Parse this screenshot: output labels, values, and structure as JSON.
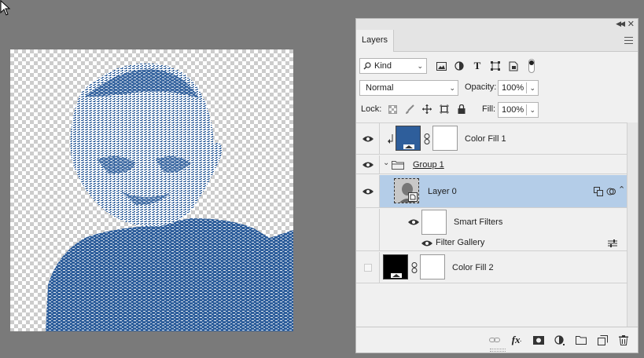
{
  "panel": {
    "tab_label": "Layers",
    "kind_filter": "Kind",
    "blend_mode": "Normal",
    "opacity_label": "Opacity:",
    "opacity_value": "100%",
    "lock_label": "Lock:",
    "fill_label": "Fill:",
    "fill_value": "100%"
  },
  "layers": [
    {
      "name": "Color Fill 1",
      "visible": true,
      "thumb_color": "#2e5e9b",
      "clipped": true
    },
    {
      "name": "Group 1",
      "visible": true,
      "type": "group"
    },
    {
      "name": "Layer 0",
      "visible": true,
      "selected": true,
      "type": "smart-object"
    },
    {
      "name": "Smart Filters",
      "visible": true,
      "type": "smart-filters"
    },
    {
      "name": "Filter Gallery",
      "visible": true,
      "type": "filter"
    },
    {
      "name": "Color Fill 2",
      "visible": false,
      "thumb_color": "#000000"
    }
  ],
  "colors": {
    "accent_selected": "#b4cde8",
    "fill_blue": "#2e5e9b",
    "canvas_bg": "#7a7a7a"
  },
  "icons": {
    "filter_icons": [
      "image-filter-icon",
      "adjustment-filter-icon",
      "type-filter-icon",
      "shape-filter-icon",
      "smart-object-filter-icon",
      "filter-toggle-icon"
    ],
    "lock_icons": [
      "lock-transparent-icon",
      "lock-paint-icon",
      "lock-position-icon",
      "lock-artboard-icon",
      "lock-all-icon"
    ],
    "bottom_icons": [
      "link-layers-icon",
      "fx-icon",
      "add-mask-icon",
      "new-adjustment-icon",
      "new-group-icon",
      "new-layer-icon",
      "delete-icon"
    ]
  }
}
